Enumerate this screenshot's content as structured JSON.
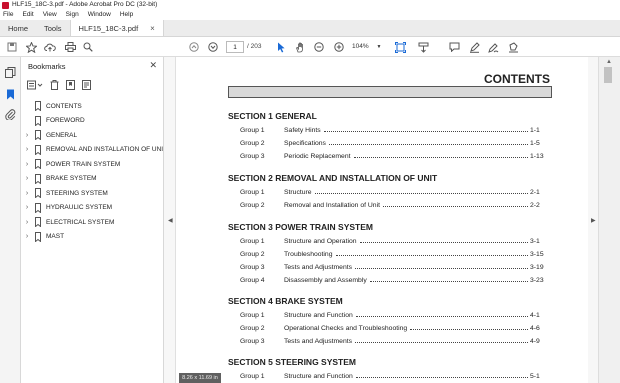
{
  "window": {
    "title": "HLF15_18C-3.pdf - Adobe Acrobat Pro DC (32-bit)"
  },
  "menu": [
    "File",
    "Edit",
    "View",
    "Sign",
    "Window",
    "Help"
  ],
  "tabs": {
    "home": "Home",
    "tools": "Tools",
    "document": "HLF15_18C-3.pdf"
  },
  "toolbar": {
    "page_current": "1",
    "page_total": "/ 203",
    "zoom": "104%"
  },
  "bookmarks": {
    "title": "Bookmarks",
    "items": [
      {
        "label": "CONTENTS",
        "expandable": false
      },
      {
        "label": "FOREWORD",
        "expandable": false
      },
      {
        "label": "GENERAL",
        "expandable": true
      },
      {
        "label": "REMOVAL AND INSTALLATION OF UNI",
        "expandable": true
      },
      {
        "label": "POWER TRAIN SYSTEM",
        "expandable": true
      },
      {
        "label": "BRAKE SYSTEM",
        "expandable": true
      },
      {
        "label": "STEERING SYSTEM",
        "expandable": true
      },
      {
        "label": "HYDRAULIC SYSTEM",
        "expandable": true
      },
      {
        "label": "ELECTRICAL SYSTEM",
        "expandable": true
      },
      {
        "label": "MAST",
        "expandable": true
      }
    ]
  },
  "document": {
    "heading": "CONTENTS",
    "sections": [
      {
        "title": "SECTION 1  GENERAL",
        "entries": [
          {
            "group": "Group  1",
            "title": "Safety Hints",
            "page": "1-1"
          },
          {
            "group": "Group  2",
            "title": "Specifications",
            "page": "1-5"
          },
          {
            "group": "Group  3",
            "title": "Periodic Replacement",
            "page": "1-13"
          }
        ]
      },
      {
        "title": "SECTION 2  REMOVAL AND INSTALLATION OF UNIT",
        "entries": [
          {
            "group": "Group  1",
            "title": "Structure",
            "page": "2-1"
          },
          {
            "group": "Group  2",
            "title": "Removal and Installation of Unit",
            "page": "2-2"
          }
        ]
      },
      {
        "title": "SECTION 3  POWER TRAIN SYSTEM",
        "entries": [
          {
            "group": "Group  1",
            "title": "Structure and Operation",
            "page": "3-1"
          },
          {
            "group": "Group  2",
            "title": "Troubleshooting",
            "page": "3-15"
          },
          {
            "group": "Group  3",
            "title": "Tests and Adjustments",
            "page": "3-19"
          },
          {
            "group": "Group  4",
            "title": "Disassembly and Assembly",
            "page": "3-23"
          }
        ]
      },
      {
        "title": "SECTION 4  BRAKE SYSTEM",
        "entries": [
          {
            "group": "Group  1",
            "title": "Structure and Function",
            "page": "4-1"
          },
          {
            "group": "Group  2",
            "title": "Operational Checks and Troubleshooting",
            "page": "4-6"
          },
          {
            "group": "Group  3",
            "title": "Tests and Adjustments",
            "page": "4-9"
          }
        ]
      },
      {
        "title": "SECTION 5  STEERING SYSTEM",
        "entries": [
          {
            "group": "Group  1",
            "title": "Structure and Function",
            "page": "5-1"
          }
        ]
      }
    ]
  },
  "status": {
    "page_size": "8.26 x 11.69 in"
  }
}
